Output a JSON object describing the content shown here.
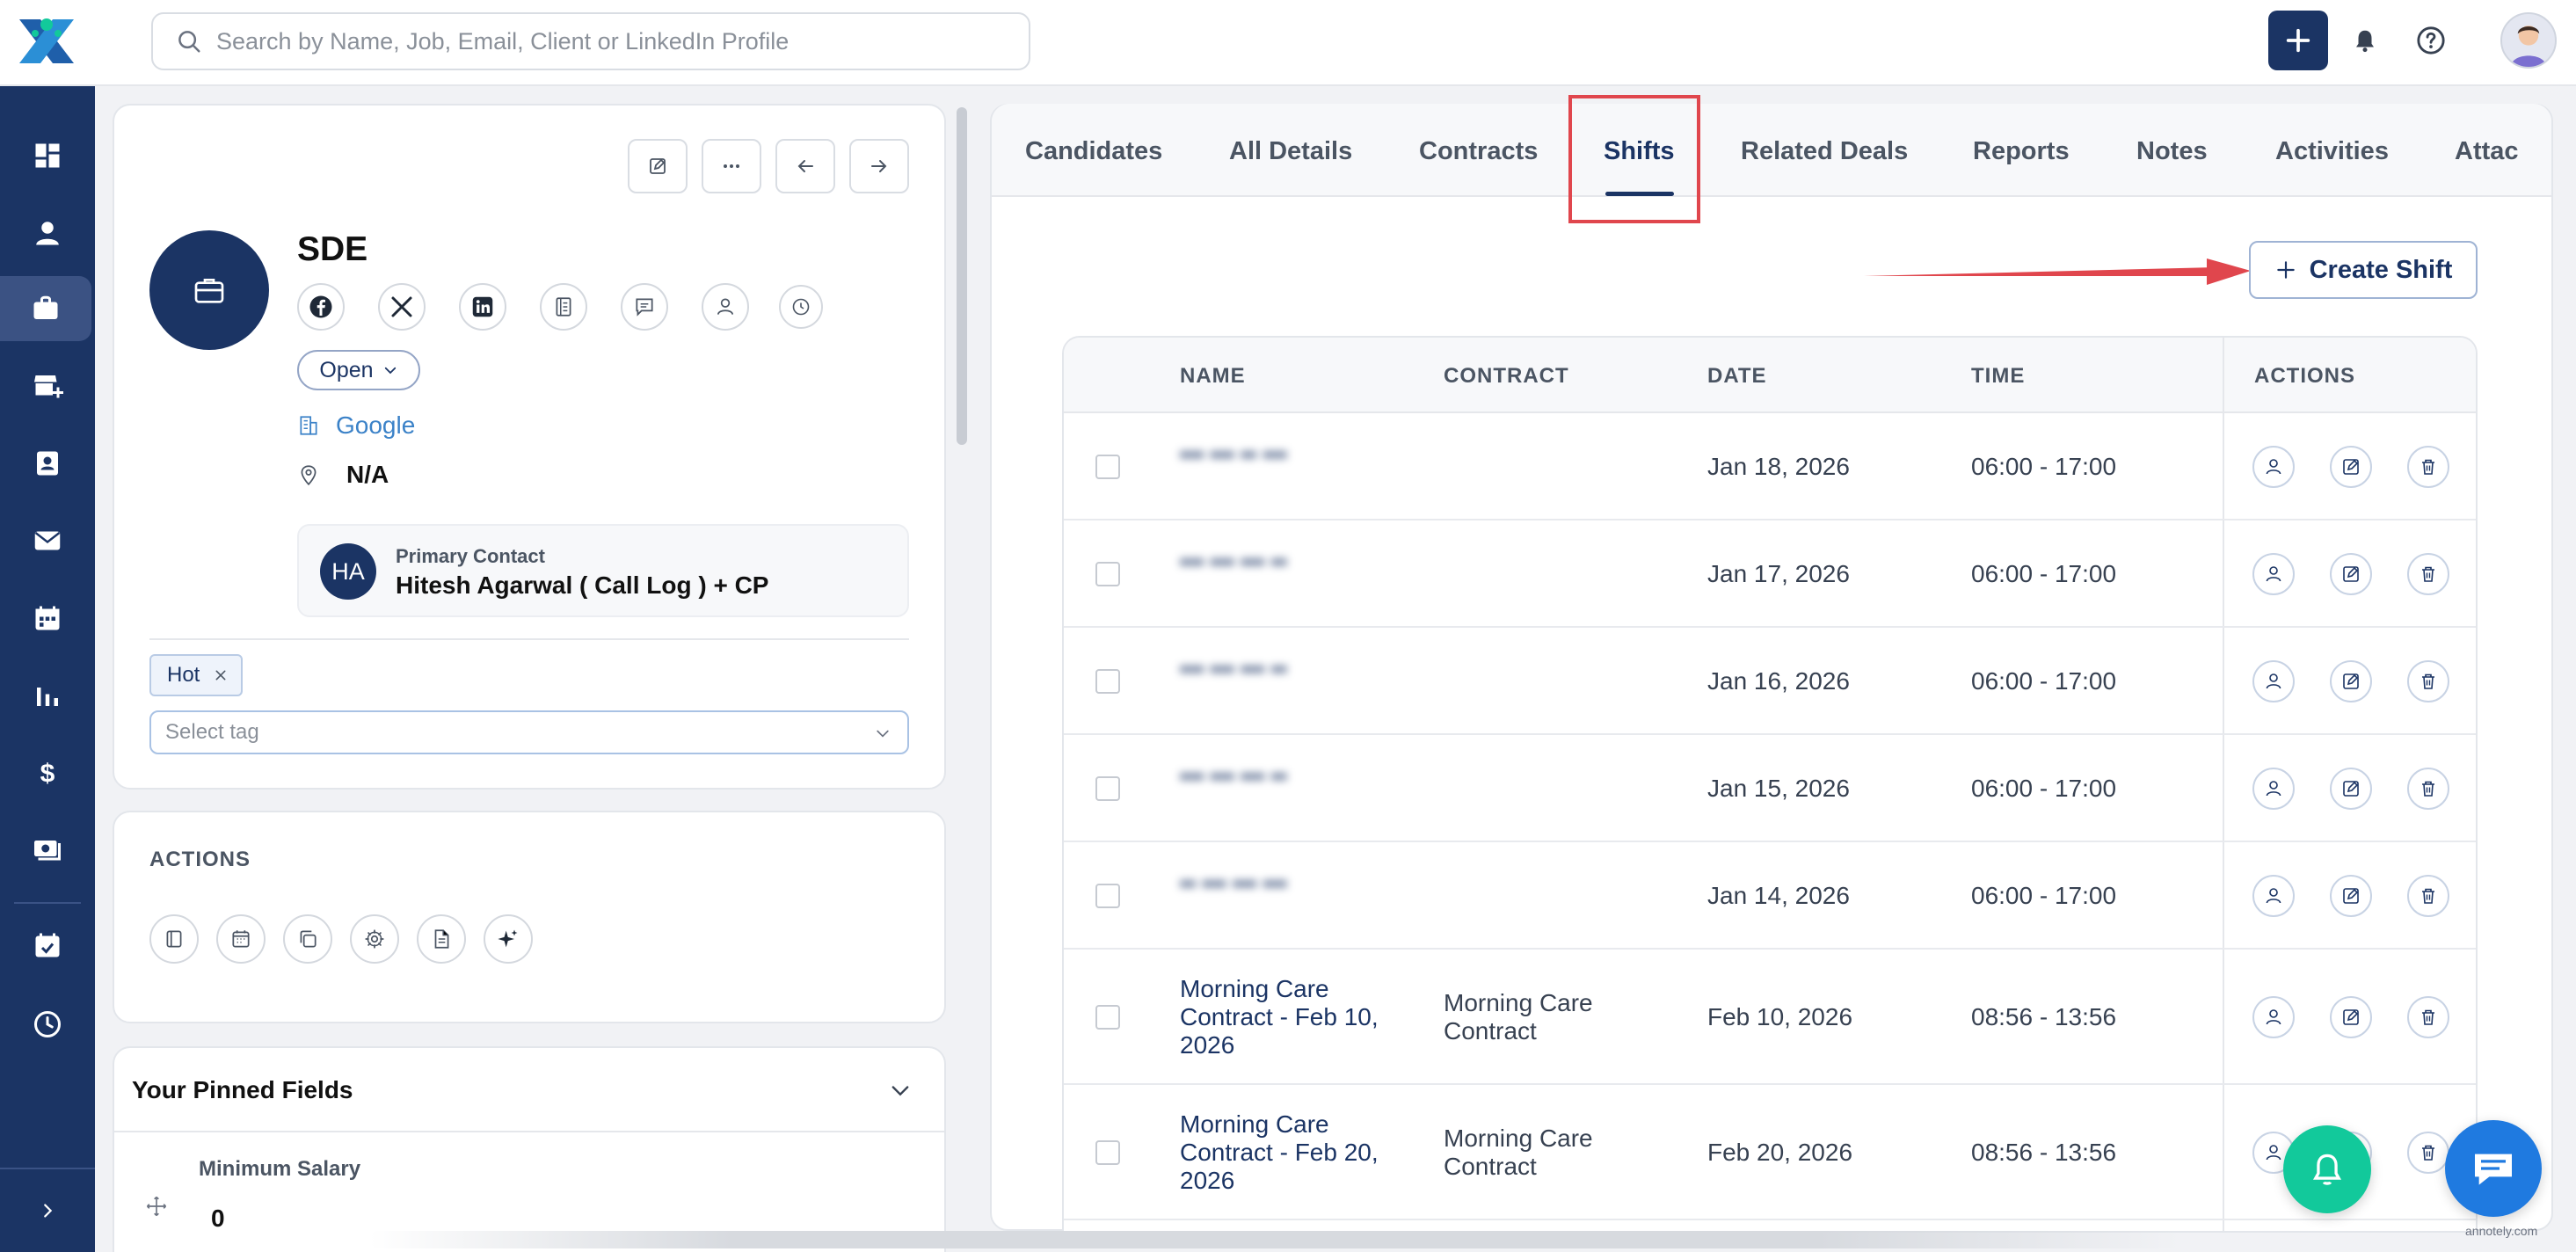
{
  "search": {
    "placeholder": "Search by Name, Job, Email, Client or LinkedIn Profile"
  },
  "job": {
    "title": "SDE",
    "status": "Open",
    "client": "Google",
    "location": "N/A",
    "primary_contact": {
      "initials": "HA",
      "role": "Primary Contact",
      "name": "Hitesh Agarwal ( Call Log ) + CP"
    },
    "tags": [
      "Hot"
    ],
    "tag_placeholder": "Select tag"
  },
  "actions_section": {
    "title": "ACTIONS"
  },
  "pinned": {
    "title": "Your Pinned Fields",
    "field_label": "Minimum Salary",
    "field_value": "0"
  },
  "tabs": [
    "Candidates",
    "All Details",
    "Contracts",
    "Shifts",
    "Related Deals",
    "Reports",
    "Notes",
    "Activities",
    "Attac"
  ],
  "active_tab": "Shifts",
  "create_shift_label": "Create Shift",
  "table": {
    "headers": {
      "name": "NAME",
      "contract": "CONTRACT",
      "date": "DATE",
      "time": "TIME",
      "actions": "ACTIONS"
    },
    "rows": [
      {
        "name": "••• ••• •• •••",
        "contract": "",
        "date": "Jan 18, 2026",
        "time": "06:00 - 17:00"
      },
      {
        "name": "••• ••• ••• ••",
        "contract": "",
        "date": "Jan 17, 2026",
        "time": "06:00 - 17:00"
      },
      {
        "name": "••• ••• ••• ••",
        "contract": "",
        "date": "Jan 16, 2026",
        "time": "06:00 - 17:00"
      },
      {
        "name": "••• ••• ••• ••",
        "contract": "",
        "date": "Jan 15, 2026",
        "time": "06:00 - 17:00"
      },
      {
        "name": "•• ••• ••• •••",
        "contract": "",
        "date": "Jan 14, 2026",
        "time": "06:00 - 17:00"
      },
      {
        "name": "Morning Care Contract - Feb 10, 2026",
        "contract": "Morning Care Contract",
        "date": "Feb 10, 2026",
        "time": "08:56 - 13:56"
      },
      {
        "name": "Morning Care Contract - Feb 20, 2026",
        "contract": "Morning Care Contract",
        "date": "Feb 20, 2026",
        "time": "08:56 - 13:56"
      }
    ]
  },
  "watermark": "annotely.com",
  "colors": {
    "brand_navy": "#1b3464",
    "accent_red": "#e0464d",
    "link_blue": "#3b82c8",
    "bell_green": "#12c99b",
    "chat_blue": "#1f7ae0"
  },
  "icons": {
    "sidebar": [
      "dashboard-icon",
      "person-icon",
      "briefcase-icon",
      "store-add-icon",
      "contact-card-icon",
      "mail-icon",
      "calendar-icon",
      "bar-chart-icon",
      "dollar-icon",
      "money-icon",
      "calendar-check-icon",
      "clock-icon"
    ]
  }
}
